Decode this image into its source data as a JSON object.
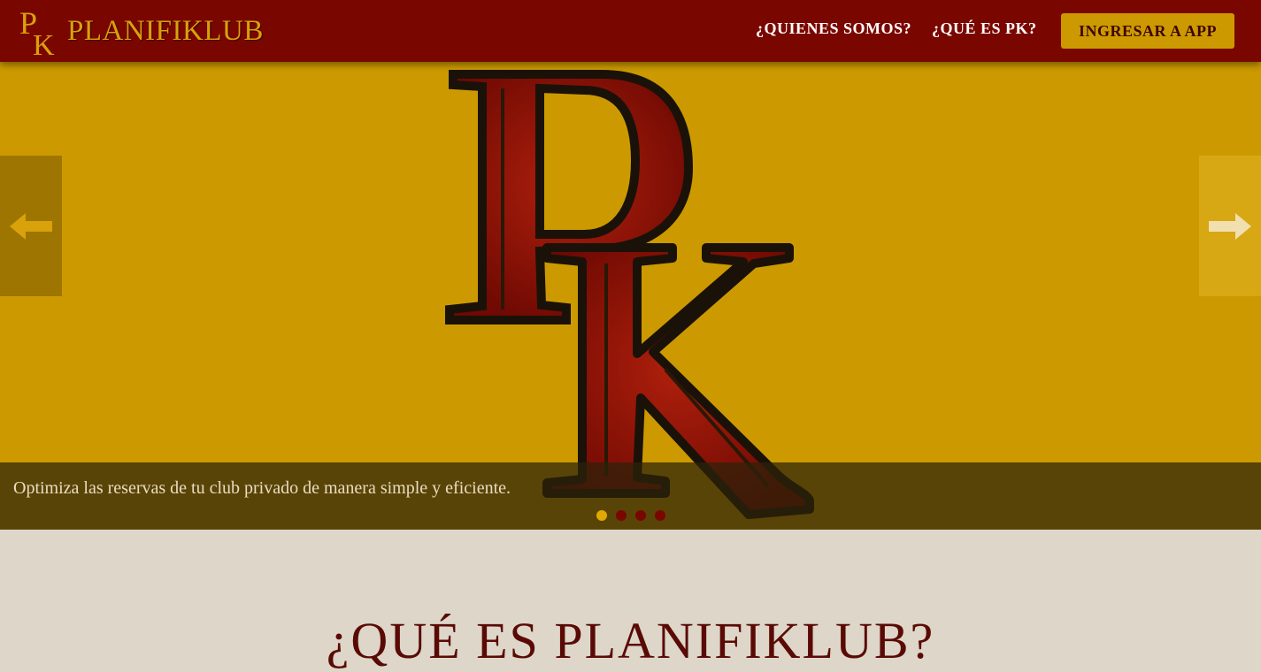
{
  "brand": {
    "monogram": "PK",
    "name": "PLANIFIKLUB"
  },
  "nav": {
    "quienes": "¿QUIENES SOMOS?",
    "que": "¿QUÉ ES PK?",
    "app": "INGRESAR A APP"
  },
  "hero": {
    "monogram": "PK",
    "caption": "Optimiza las reservas de tu club privado de manera simple y eficiente.",
    "slides": [
      {
        "active": true
      },
      {
        "active": false
      },
      {
        "active": false
      },
      {
        "active": false
      }
    ]
  },
  "section": {
    "title": "¿QUÉ ES PLANIFIKLUB?"
  },
  "icons": {
    "prev": "arrow-left-icon",
    "next": "arrow-right-icon"
  },
  "colors": {
    "navbar": "#7a0600",
    "brand_gold": "#d9a10a",
    "hero_bg": "#cc9a00",
    "letter_red": "#8b0f06",
    "page_bg": "#ddd6c9",
    "title": "#5a0a05"
  }
}
